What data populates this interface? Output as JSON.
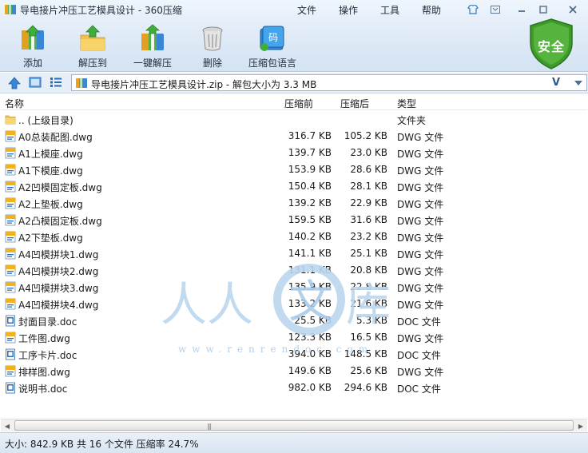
{
  "window": {
    "title": "导电接片冲压工艺模具设计 - 360压缩",
    "menus": [
      "文件",
      "操作",
      "工具",
      "帮助"
    ]
  },
  "toolbar": {
    "add": "添加",
    "extract_to": "解压到",
    "one_click_extract": "一键解压",
    "delete": "删除",
    "compress_voice": "压缩包语言"
  },
  "security_badge": "安全",
  "address": {
    "path": "导电接片冲压工艺模具设计.zip - 解包大小为 3.3 MB",
    "v_label": "V"
  },
  "columns": {
    "name": "名称",
    "before": "压缩前",
    "after": "压缩后",
    "type": "类型"
  },
  "files": [
    {
      "name": ".. (上级目录)",
      "before": "",
      "after": "",
      "type": "文件夹",
      "icon": "folder-icon"
    },
    {
      "name": "A0总装配图.dwg",
      "before": "316.7 KB",
      "after": "105.2 KB",
      "type": "DWG 文件",
      "icon": "dwg-file-icon"
    },
    {
      "name": "A1上模座.dwg",
      "before": "139.7 KB",
      "after": "23.0 KB",
      "type": "DWG 文件",
      "icon": "dwg-file-icon"
    },
    {
      "name": "A1下模座.dwg",
      "before": "153.9 KB",
      "after": "28.6 KB",
      "type": "DWG 文件",
      "icon": "dwg-file-icon"
    },
    {
      "name": "A2凹模固定板.dwg",
      "before": "150.4 KB",
      "after": "28.1 KB",
      "type": "DWG 文件",
      "icon": "dwg-file-icon"
    },
    {
      "name": "A2上垫板.dwg",
      "before": "139.2 KB",
      "after": "22.9 KB",
      "type": "DWG 文件",
      "icon": "dwg-file-icon"
    },
    {
      "name": "A2凸模固定板.dwg",
      "before": "159.5 KB",
      "after": "31.6 KB",
      "type": "DWG 文件",
      "icon": "dwg-file-icon"
    },
    {
      "name": "A2下垫板.dwg",
      "before": "140.2 KB",
      "after": "23.2 KB",
      "type": "DWG 文件",
      "icon": "dwg-file-icon"
    },
    {
      "name": "A4凹模拼块1.dwg",
      "before": "141.1 KB",
      "after": "25.1 KB",
      "type": "DWG 文件",
      "icon": "dwg-file-icon"
    },
    {
      "name": "A4凹模拼块2.dwg",
      "before": "131.1 KB",
      "after": "20.8 KB",
      "type": "DWG 文件",
      "icon": "dwg-file-icon"
    },
    {
      "name": "A4凹模拼块3.dwg",
      "before": "135.9 KB",
      "after": "22.8 KB",
      "type": "DWG 文件",
      "icon": "dwg-file-icon"
    },
    {
      "name": "A4凹模拼块4.dwg",
      "before": "133.2 KB",
      "after": "21.6 KB",
      "type": "DWG 文件",
      "icon": "dwg-file-icon"
    },
    {
      "name": "封面目录.doc",
      "before": "25.5 KB",
      "after": "5.3 KB",
      "type": "DOC 文件",
      "icon": "doc-file-icon"
    },
    {
      "name": "工件图.dwg",
      "before": "123.3 KB",
      "after": "16.5 KB",
      "type": "DWG 文件",
      "icon": "dwg-file-icon"
    },
    {
      "name": "工序卡片.doc",
      "before": "394.0 KB",
      "after": "148.5 KB",
      "type": "DOC 文件",
      "icon": "doc-file-icon"
    },
    {
      "name": "排样图.dwg",
      "before": "149.6 KB",
      "after": "25.6 KB",
      "type": "DWG 文件",
      "icon": "dwg-file-icon"
    },
    {
      "name": "说明书.doc",
      "before": "982.0 KB",
      "after": "294.6 KB",
      "type": "DOC 文件",
      "icon": "doc-file-icon"
    }
  ],
  "status": "大小: 842.9 KB 共 16 个文件 压缩率 24.7%",
  "watermark_text": "www.renrendoc.com",
  "colors": {
    "accent": "#2b6cb0",
    "shield_green": "#3e9a2a"
  }
}
